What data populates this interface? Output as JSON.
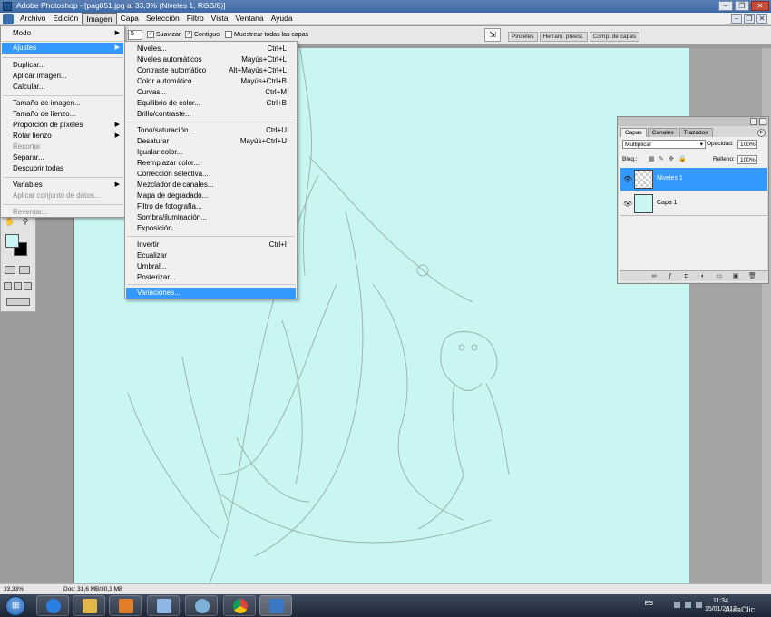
{
  "window": {
    "title": "Adobe Photoshop - [pag051.jpg al 33,3% (Niveles 1, RGB/8)]"
  },
  "menubar": {
    "items": [
      "Archivo",
      "Edición",
      "Imagen",
      "Capa",
      "Selección",
      "Filtro",
      "Vista",
      "Ventana",
      "Ayuda"
    ],
    "active": "Imagen"
  },
  "options": {
    "tolerance_value": "5",
    "suavizar": "Suavizar",
    "contiguo": "Contiguo",
    "muestrear": "Muestrear todas las capas"
  },
  "palette_well": {
    "tabs": [
      "Pinceles",
      "Herram. preest.",
      "Comp. de capas"
    ]
  },
  "image_menu": {
    "items": [
      {
        "label": "Modo",
        "arrow": true
      },
      {
        "label": "Ajustes",
        "arrow": true,
        "highlighted": true
      },
      {
        "label": "Duplicar..."
      },
      {
        "label": "Aplicar imagen..."
      },
      {
        "label": "Calcular..."
      },
      {
        "label": "Tamaño de imagen..."
      },
      {
        "label": "Tamaño de lienzo..."
      },
      {
        "label": "Proporción de píxeles",
        "arrow": true
      },
      {
        "label": "Rotar lienzo",
        "arrow": true
      },
      {
        "label": "Recortar",
        "disabled": true
      },
      {
        "label": "Separar..."
      },
      {
        "label": "Descubrir todas"
      },
      {
        "label": "Variables",
        "arrow": true
      },
      {
        "label": "Aplicar conjunto de datos...",
        "disabled": true
      },
      {
        "label": "Reventar...",
        "disabled": true
      }
    ]
  },
  "adjust_menu": {
    "items": [
      {
        "label": "Niveles...",
        "shortcut": "Ctrl+L"
      },
      {
        "label": "Niveles automáticos",
        "shortcut": "Mayús+Ctrl+L"
      },
      {
        "label": "Contraste automático",
        "shortcut": "Alt+Mayús+Ctrl+L"
      },
      {
        "label": "Color automático",
        "shortcut": "Mayús+Ctrl+B"
      },
      {
        "label": "Curvas...",
        "shortcut": "Ctrl+M"
      },
      {
        "label": "Equilibrio de color...",
        "shortcut": "Ctrl+B"
      },
      {
        "label": "Brillo/contraste...",
        "shortcut": ""
      },
      {
        "label": "Tono/saturación...",
        "shortcut": "Ctrl+U"
      },
      {
        "label": "Desaturar",
        "shortcut": "Mayús+Ctrl+U"
      },
      {
        "label": "Igualar color...",
        "shortcut": ""
      },
      {
        "label": "Reemplazar color...",
        "shortcut": ""
      },
      {
        "label": "Corrección selectiva...",
        "shortcut": ""
      },
      {
        "label": "Mezclador de canales...",
        "shortcut": ""
      },
      {
        "label": "Mapa de degradado...",
        "shortcut": ""
      },
      {
        "label": "Filtro de fotografía...",
        "shortcut": ""
      },
      {
        "label": "Sombra/iluminación...",
        "shortcut": ""
      },
      {
        "label": "Exposición...",
        "shortcut": ""
      },
      {
        "label": "Invertir",
        "shortcut": "Ctrl+I"
      },
      {
        "label": "Ecualizar",
        "shortcut": ""
      },
      {
        "label": "Umbral...",
        "shortcut": ""
      },
      {
        "label": "Posterizar...",
        "shortcut": ""
      },
      {
        "label": "Variaciones...",
        "shortcut": "",
        "highlighted": true
      }
    ]
  },
  "layers_panel": {
    "tabs": [
      "Capas",
      "Canales",
      "Trazados"
    ],
    "blend_mode": "Multiplicar",
    "opacity_label": "Opacidad:",
    "opacity": "100%",
    "lock_label": "Bloq.:",
    "fill_label": "Relleno:",
    "fill": "100%",
    "layers": [
      {
        "name": "Niveles 1",
        "selected": true
      },
      {
        "name": "Capa 1",
        "selected": false
      }
    ]
  },
  "status": {
    "zoom": "33,33%",
    "doc": "Doc: 31,6 MB/30,3 MB"
  },
  "taskbar": {
    "lang": "ES",
    "time": "11:34",
    "date": "15/01/2012",
    "watermark": "AulaClic"
  },
  "colors": {
    "canvas": "#c9f6f2",
    "highlight": "#3399ff",
    "workspace": "#9c9c9c"
  }
}
